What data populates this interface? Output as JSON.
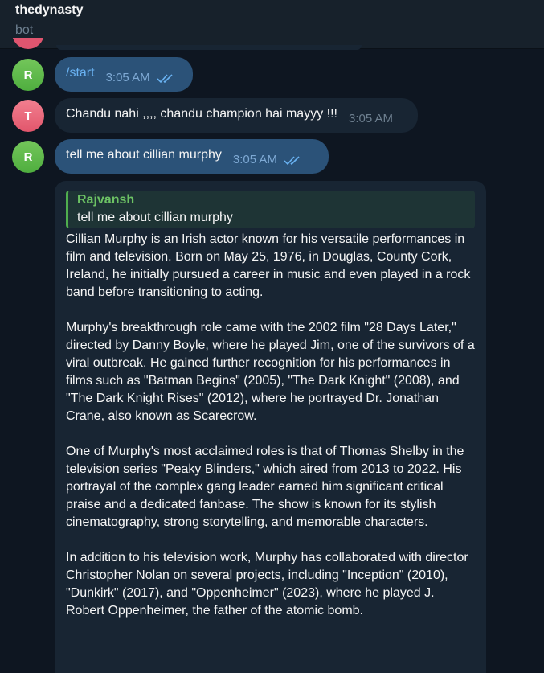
{
  "header": {
    "title": "thedynasty",
    "subtitle": "bot"
  },
  "messages": [
    {
      "avatar_letter": "R",
      "text": "/start",
      "time": "3:05 AM"
    },
    {
      "avatar_letter": "T",
      "text": "Chandu nahi ,,,, chandu champion hai mayyy !!!",
      "time": "3:05 AM"
    },
    {
      "avatar_letter": "R",
      "text": "tell me about cillian murphy",
      "time": "3:05 AM"
    }
  ],
  "reply_message": {
    "quote_author": "Rajvansh",
    "quote_text": "tell me about cillian murphy",
    "paragraphs": [
      "Cillian Murphy is an Irish actor known for his versatile performances in film and television. Born on May 25, 1976, in Douglas, County Cork, Ireland, he initially pursued a career in music and even played in a rock band before transitioning to acting.",
      "Murphy's breakthrough role came with the 2002 film \"28 Days Later,\" directed by Danny Boyle, where he played Jim, one of the survivors of a viral outbreak. He gained further recognition for his performances in films such as \"Batman Begins\" (2005), \"The Dark Knight\" (2008), and \"The Dark Knight Rises\" (2012), where he portrayed Dr. Jonathan Crane, also known as Scarecrow.",
      "One of Murphy's most acclaimed roles is that of Thomas Shelby in the television series \"Peaky Blinders,\" which aired from 2013 to 2022. His portrayal of the complex gang leader earned him significant critical praise and a dedicated fanbase. The show is known for its stylish cinematography, strong storytelling, and memorable characters.",
      "In addition to his television work, Murphy has collaborated with director Christopher Nolan on several projects, including \"Inception\" (2010), \"Dunkirk\" (2017), and \"Oppenheimer\" (2023), where he played J. Robert Oppenheimer, the father of the atomic bomb."
    ]
  },
  "colors": {
    "background": "#0e1621",
    "outgoing_bubble": "#2b5278",
    "incoming_bubble": "#182533",
    "reply_accent": "#4fae4e"
  },
  "icons": {
    "read_receipt": "double-check-icon"
  }
}
